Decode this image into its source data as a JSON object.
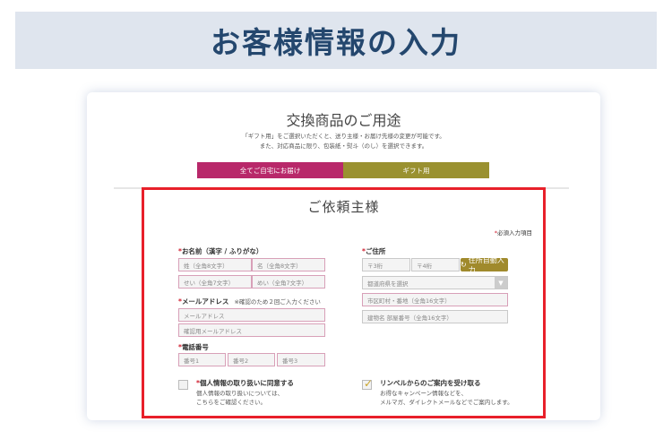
{
  "banner": {
    "title": "お客様情報の入力"
  },
  "usage": {
    "title": "交換商品のご用途",
    "desc_line1": "「ギフト用」をご選択いただくと、送り主様・お届け先様の変更が可能です。",
    "desc_line2": "また、対応商品に限り、包装紙・熨斗（のし）を選択できます。",
    "options": [
      {
        "label": "全てご自宅にお届け",
        "selected": true,
        "color": "#b8286a"
      },
      {
        "label": "ギフト用",
        "selected": false,
        "color": "#9a9130"
      }
    ]
  },
  "requester": {
    "title": "ご依頼主様",
    "required_mark": "*",
    "required_note": "必須入力項目",
    "name": {
      "label": "お名前（漢字 / ふりがな）",
      "placeholders": {
        "last_kanji": "姓（全角8文字）",
        "first_kanji": "名（全角8文字）",
        "last_kana": "せい（全角7文字）",
        "first_kana": "めい（全角7文字）"
      }
    },
    "email": {
      "label": "メールアドレス",
      "note": "※確認のため２回ご入力ください",
      "placeholder": "メールアドレス",
      "confirm_placeholder": "確認用メールアドレス"
    },
    "phone": {
      "label": "電話番号",
      "placeholders": [
        "番号1",
        "番号2",
        "番号3"
      ]
    },
    "address": {
      "label": "ご住所",
      "zip1_placeholder": "〒3桁",
      "zip2_placeholder": "〒4桁",
      "autofill_button": "住所自動入力",
      "prefecture_placeholder": "都道府県を選択",
      "city_placeholder": "市区町村・番地（全角16文字）",
      "building_placeholder": "建物名 部屋番号（全角16文字）"
    },
    "privacy": {
      "title": "個人情報の取り扱いに同意する",
      "desc_line1": "個人情報の取り扱いについては、",
      "desc_line2": "こちらをご確認ください。",
      "checked": false
    },
    "newsletter": {
      "title": "リンベルからのご案内を受け取る",
      "desc_line1": "お得なキャンペーン情報などを、",
      "desc_line2": "メルマガ、ダイレクトメールなどでご案内します。",
      "checked": true
    }
  },
  "colors": {
    "banner_bg": "#dfe5ee",
    "banner_text": "#24476e",
    "required": "#d12030",
    "highlight_border": "#e8202a"
  }
}
